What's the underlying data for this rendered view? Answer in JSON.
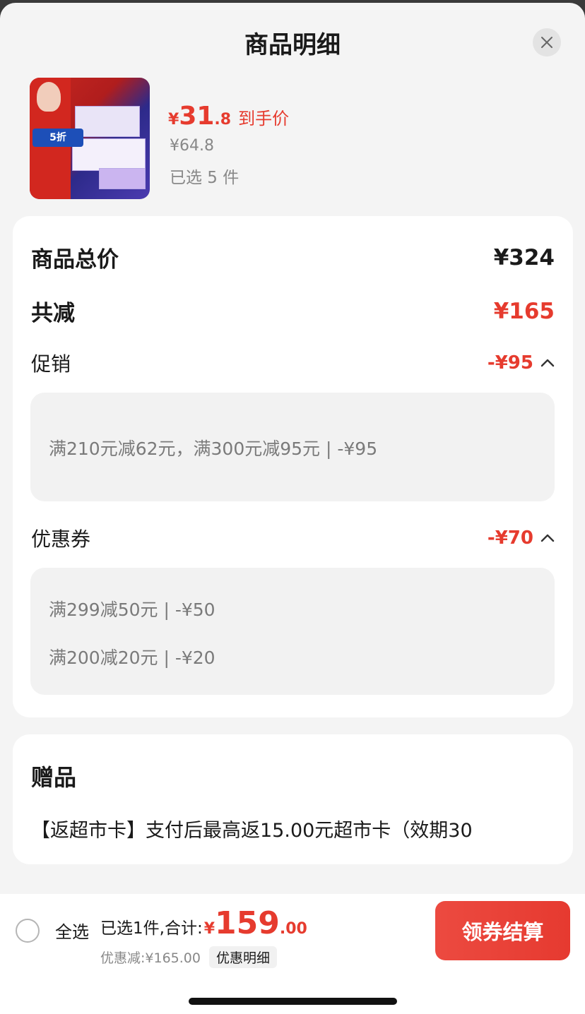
{
  "sheet": {
    "title": "商品明细"
  },
  "product": {
    "price_symbol": "¥",
    "price_int": "31",
    "price_dec": ".8",
    "price_tag": "到手价",
    "original_price": "¥64.8",
    "selected_count": "已选 5 件",
    "thumb_badge": "5折"
  },
  "totals": {
    "total_label": "商品总价",
    "total_value": "¥324",
    "reduce_label": "共减",
    "reduce_value": "¥165"
  },
  "promotion": {
    "label": "促销",
    "value": "-¥95",
    "details": [
      "满210元减62元，满300元减95元 | -¥95"
    ]
  },
  "coupon": {
    "label": "优惠券",
    "value": "-¥70",
    "details": [
      "满299减50元 | -¥50",
      "满200减20元 | -¥20"
    ]
  },
  "gift": {
    "title": "赠品",
    "description": "【返超市卡】支付后最高返15.00元超市卡（效期30"
  },
  "bottom_bar": {
    "select_all": "全选",
    "summary_label": "已选1件,合计:",
    "total_symbol": "¥",
    "total_int": "159",
    "total_dec": ".00",
    "discount_text": "优惠减:¥165.00",
    "discount_detail_button": "优惠明细",
    "checkout_button": "领券结算"
  },
  "colors": {
    "accent_red": "#e63b2e",
    "sheet_bg": "#f4f4f4",
    "card_bg": "#ffffff",
    "muted_text": "#888888"
  }
}
